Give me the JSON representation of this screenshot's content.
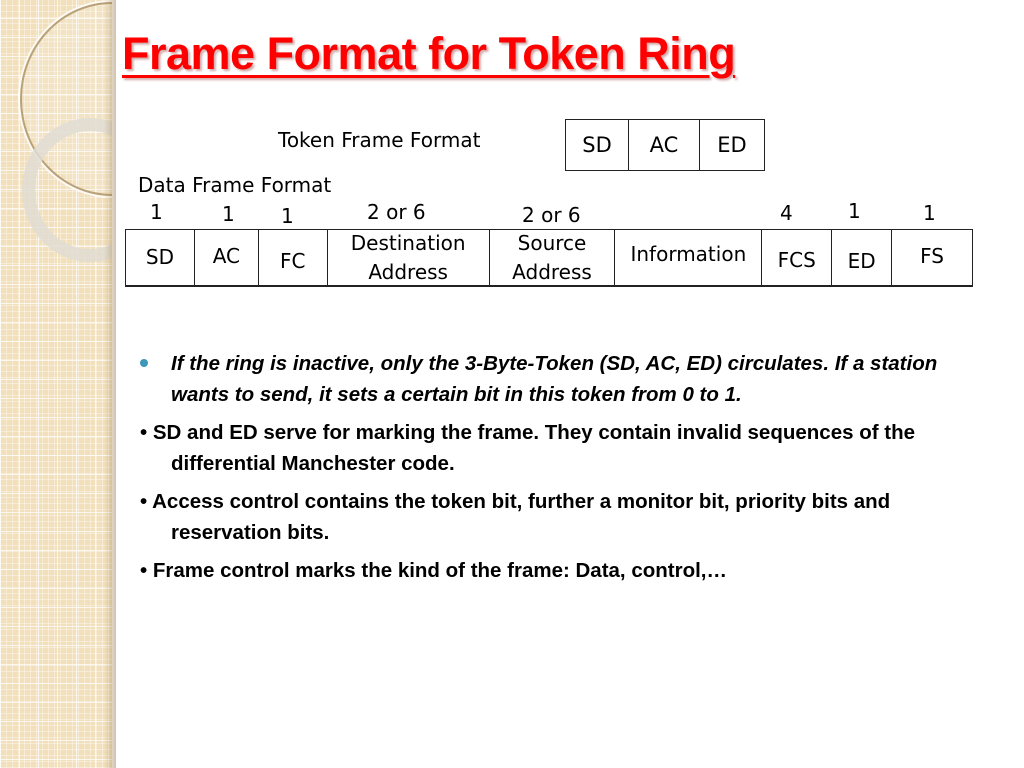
{
  "title": "Frame Format for Token Ring",
  "colors": {
    "title": "#ff0000",
    "bullet_dot": "#3d97b6",
    "sidebar": "#f2e0bd"
  },
  "token_frame": {
    "label": "Token Frame Format",
    "fields": [
      "SD",
      "AC",
      "ED"
    ]
  },
  "data_frame": {
    "label": "Data Frame Format",
    "fields": [
      {
        "name": "SD",
        "size": "1"
      },
      {
        "name": "AC",
        "size": "1"
      },
      {
        "name": "FC",
        "size": "1"
      },
      {
        "name": "Destination Address",
        "size": "2 or 6"
      },
      {
        "name": "Source Address",
        "size": "2 or 6"
      },
      {
        "name": "Information",
        "size": ""
      },
      {
        "name": "FCS",
        "size": "4"
      },
      {
        "name": "ED",
        "size": "1"
      },
      {
        "name": "FS",
        "size": "1"
      }
    ]
  },
  "bullets": [
    {
      "marker": "dot-icon",
      "text": "If the ring is inactive, only the 3-Byte-Token (SD, AC, ED) circulates. If a station wants to send, it sets a certain bit in this token from 0 to 1."
    },
    {
      "marker": "•",
      "text": "SD and ED serve for marking the frame. They contain invalid sequences of the differential Manchester code."
    },
    {
      "marker": "•",
      "text": "Access control contains the token bit, further a monitor bit, priority bits and reservation bits."
    },
    {
      "marker": "•",
      "text": "Frame control marks the kind of the frame: Data, control,…"
    }
  ]
}
